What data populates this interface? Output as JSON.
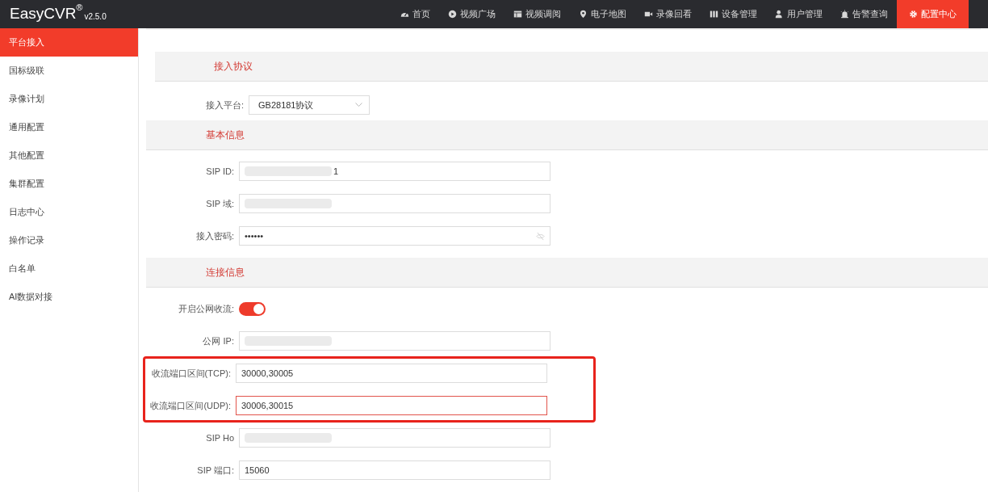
{
  "app": {
    "name": "EasyCVR",
    "mark": "®",
    "version": "v2.5.0"
  },
  "nav": [
    {
      "label": "首页",
      "selected": false
    },
    {
      "label": "视频广场",
      "selected": false
    },
    {
      "label": "视频调阅",
      "selected": false
    },
    {
      "label": "电子地图",
      "selected": false
    },
    {
      "label": "录像回看",
      "selected": false
    },
    {
      "label": "设备管理",
      "selected": false
    },
    {
      "label": "用户管理",
      "selected": false
    },
    {
      "label": "告警查询",
      "selected": false
    },
    {
      "label": "配置中心",
      "selected": true
    }
  ],
  "sidebar": {
    "items": [
      {
        "label": "平台接入",
        "selected": true
      },
      {
        "label": "国标级联",
        "selected": false
      },
      {
        "label": "录像计划",
        "selected": false
      },
      {
        "label": "通用配置",
        "selected": false
      },
      {
        "label": "其他配置",
        "selected": false
      },
      {
        "label": "集群配置",
        "selected": false
      },
      {
        "label": "日志中心",
        "selected": false
      },
      {
        "label": "操作记录",
        "selected": false
      },
      {
        "label": "白名单",
        "selected": false
      },
      {
        "label": "AI数据对接",
        "selected": false
      }
    ]
  },
  "sections": [
    {
      "title": "接入协议",
      "fields": [
        {
          "kind": "select",
          "label": "接入平台:",
          "value": "GB28181协议"
        }
      ]
    },
    {
      "title": "基本信息",
      "fields": [
        {
          "kind": "text",
          "label": "SIP ID:",
          "value": "1",
          "redacted": true
        },
        {
          "kind": "text",
          "label": "SIP 域:",
          "redacted": true
        },
        {
          "kind": "password",
          "label": "接入密码:",
          "value": "••••••"
        }
      ]
    },
    {
      "title": "连接信息",
      "fields": [
        {
          "kind": "toggle",
          "label": "开启公网收流:",
          "on": true
        },
        {
          "kind": "text",
          "label": "公网 IP:",
          "redacted": true
        },
        {
          "kind": "text",
          "label": "收流端口区间(TCP):",
          "value": "30000,30005",
          "highlighted": true
        },
        {
          "kind": "text",
          "label": "收流端口区间(UDP):",
          "value": "30006,30015",
          "highlighted": true,
          "focused": true
        },
        {
          "kind": "text",
          "label": "SIP Ho",
          "redacted": true
        },
        {
          "kind": "text",
          "label": "SIP 端口:",
          "value": "15060"
        }
      ]
    }
  ]
}
